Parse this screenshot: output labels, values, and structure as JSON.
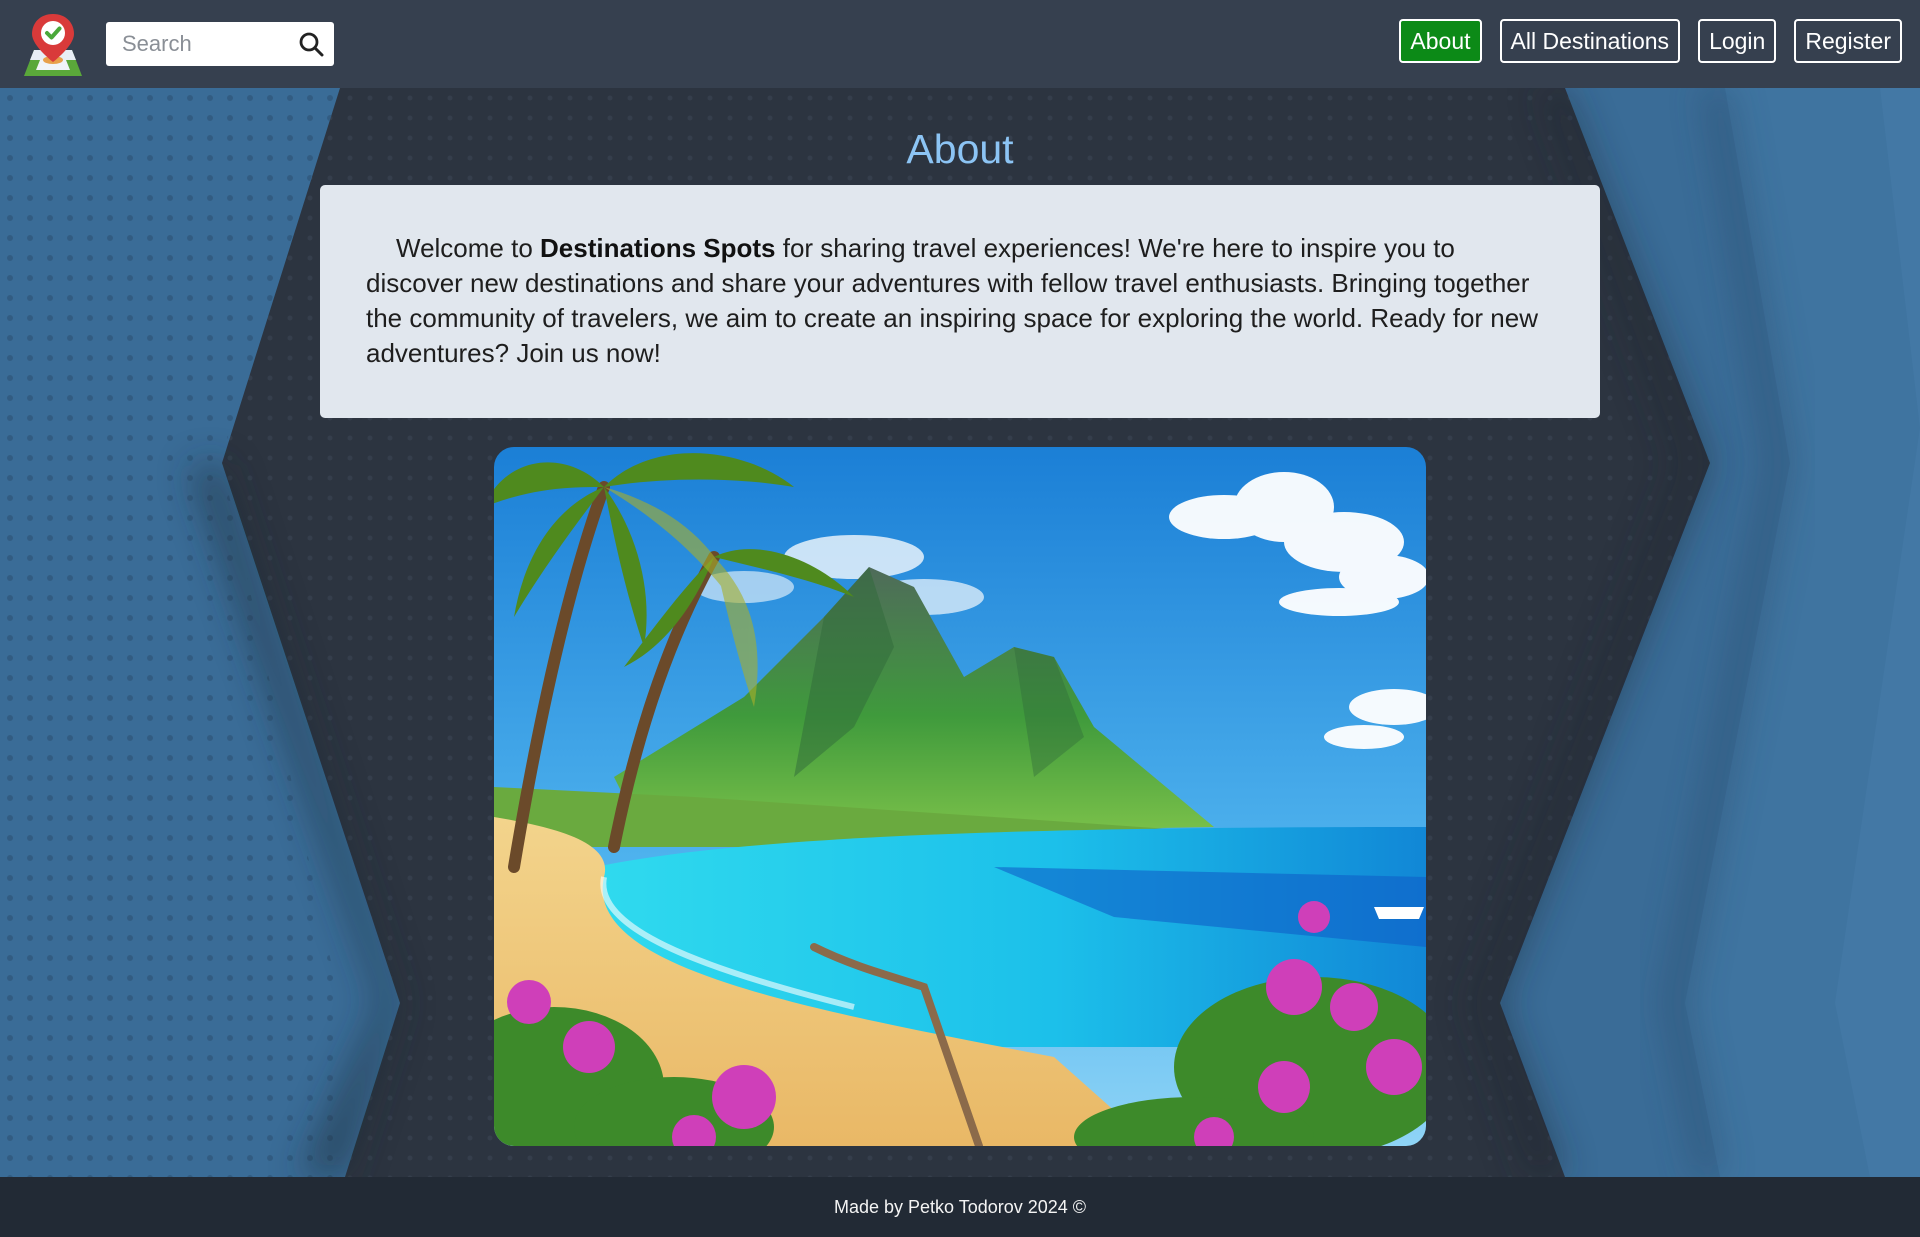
{
  "header": {
    "logo_icon": "map-pin-check-icon",
    "search": {
      "placeholder": "Search",
      "value": "",
      "icon": "search-icon"
    },
    "nav": [
      {
        "label": "About",
        "active": true
      },
      {
        "label": "All Destinations",
        "active": false
      },
      {
        "label": "Login",
        "active": false
      },
      {
        "label": "Register",
        "active": false
      }
    ]
  },
  "main": {
    "title": "About",
    "intro_before": "Welcome to ",
    "brand": "Destinations Spots",
    "intro_after": " for sharing travel experiences! We're here to inspire you to discover new destinations and share your adventures with fellow travel enthusiasts. Bringing together the community of travelers, we aim to create an inspiring space for exploring the world. Ready for new adventures? Join us now!",
    "hero_image": "tropical-beach-with-mountain-palms-and-flowers"
  },
  "footer": {
    "text": "Made by Petko Todorov 2024 ©"
  },
  "colors": {
    "header_bg": "#36404f",
    "active_button": "#0c8a17",
    "title": "#8cc4f4",
    "card_bg": "#e1e7ee",
    "footer_bg": "#222a35",
    "side_blue": "#3b6f9a"
  }
}
